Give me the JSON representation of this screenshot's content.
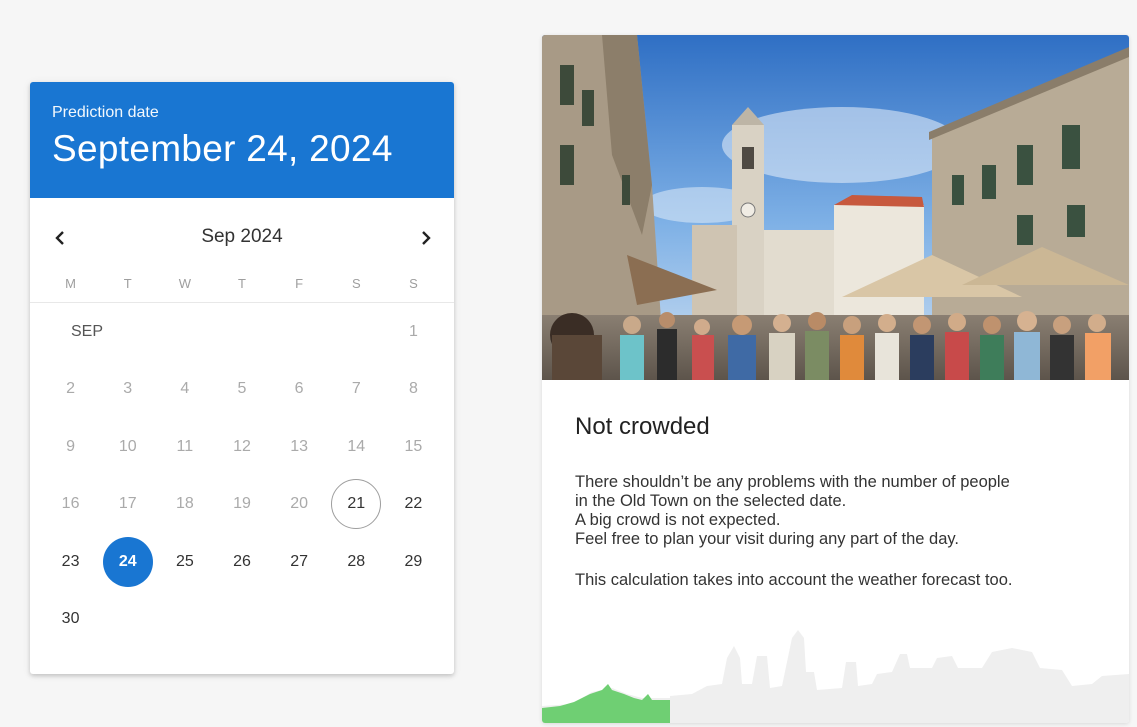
{
  "picker": {
    "subtitle": "Prediction date",
    "selected_date": "September 24, 2024",
    "month_label": "Sep 2024",
    "month_tag": "SEP",
    "weekdays": [
      "M",
      "T",
      "W",
      "T",
      "F",
      "S",
      "S"
    ],
    "weeks": [
      [
        "",
        "",
        "",
        "",
        "",
        "",
        "1"
      ],
      [
        "2",
        "3",
        "4",
        "5",
        "6",
        "7",
        "8"
      ],
      [
        "9",
        "10",
        "11",
        "12",
        "13",
        "14",
        "15"
      ],
      [
        "16",
        "17",
        "18",
        "19",
        "20",
        "21",
        "22"
      ],
      [
        "23",
        "24",
        "25",
        "26",
        "27",
        "28",
        "29"
      ],
      [
        "30",
        "",
        "",
        "",
        "",
        "",
        ""
      ]
    ],
    "today": "21",
    "selected": "24",
    "accent_color": "#1976d2",
    "prev_icon": "chevron-left-icon",
    "next_icon": "chevron-right-icon"
  },
  "result": {
    "title": "Not crowded",
    "lines": [
      "There shouldn’t be any problems with the number of people",
      "in the Old Town on the selected date.",
      "A big crowd is not expected.",
      "Feel free to plan your visit during any part of the day."
    ],
    "note": "This calculation takes into account the weather forecast too.",
    "indicator_color": "#6fcf73"
  }
}
